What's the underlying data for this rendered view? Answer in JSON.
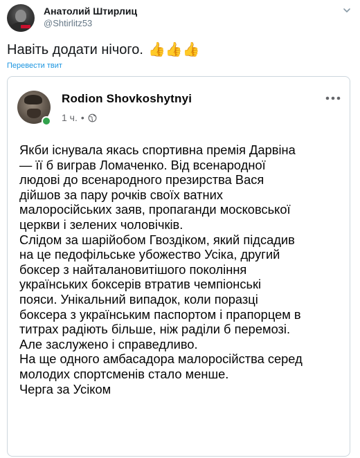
{
  "tweet": {
    "author_name": "Анатолий Штирлиц",
    "author_handle": "@Shtirlitz53",
    "text": "Навіть додати нічого.",
    "emoji": "👍👍👍",
    "translate_label": "Перевести твит"
  },
  "quoted_post": {
    "author_name": "Rodion Shovkoshytnyi",
    "time": "1 ч.",
    "separator": "•",
    "body": "Якби існувала якась спортивна премія Дарвіна\n— її б виграв Ломаченко. Від всенародної\nлюдові до всенародного презирства Вася\nдійшов за пару рочків своїх ватних\nмалоросійських заяв, пропаганди московської\nцеркви і зелених чоловічків.\nСлідом за шарійобом Гвоздіком, який підсадив\nна це педофільське убожество Усіка, другий\nбоксер з найталановитішого покоління\nукраїнських боксерів втратив чемпіонські\nпояси. Унікальний випадок, коли поразці\nбоксера з українським паспортом і прапорцем в\nтитрах радіють більше, ніж раділи б перемозі.\nАле заслужено і справедливо.\nНа ще одного амбасадора малоросійства серед\nмолодих спортсменів стало менше.\nЧерга за Усіком"
  },
  "icons": {
    "caret": "chevron-down-icon",
    "globe": "globe-icon",
    "more": "more-dots-icon"
  },
  "colors": {
    "link": "#1b95e0",
    "online": "#31a24c",
    "muted": "#657786"
  }
}
